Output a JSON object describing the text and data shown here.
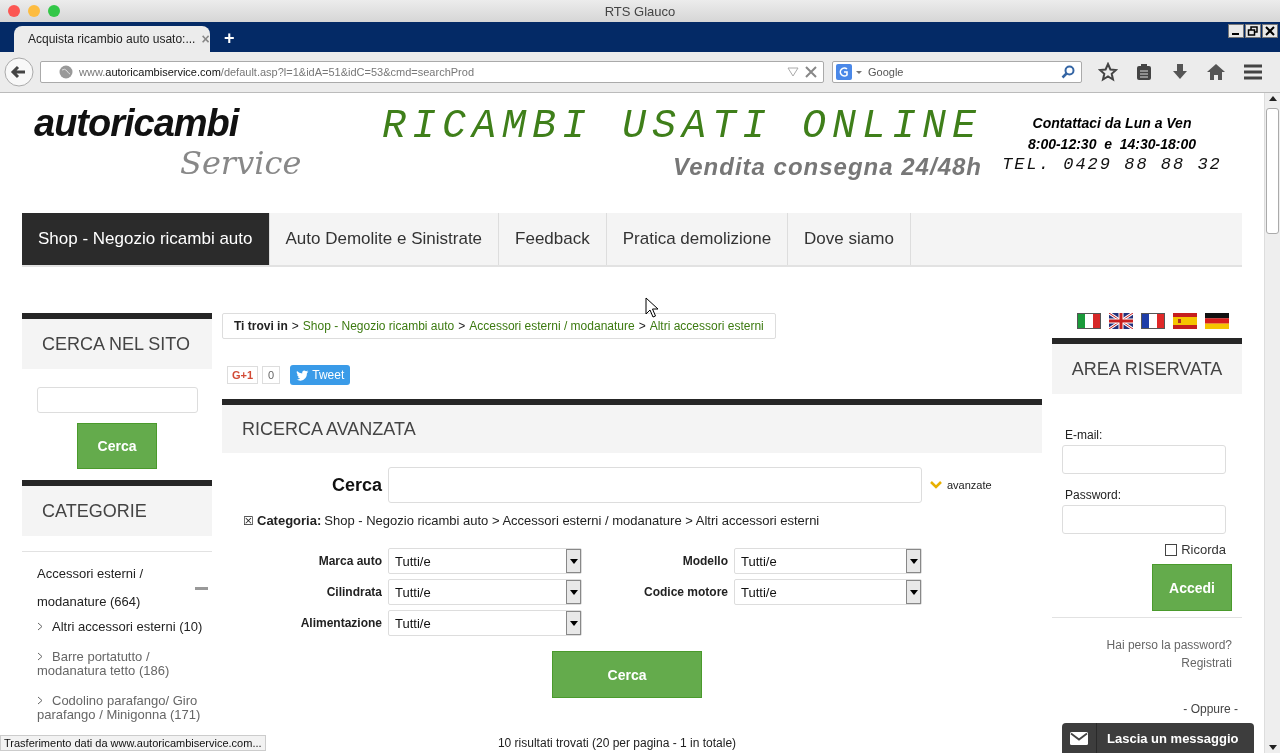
{
  "window": {
    "title": "RTS Glauco"
  },
  "browser": {
    "tab": {
      "title": "Acquista ricambio auto usato:...",
      "close": "×",
      "selected": true
    },
    "new_tab": "+",
    "url": {
      "prefix": "www.",
      "domain": "autoricambiservice.com",
      "path": "/default.asp?l=1&idA=51&idC=53&cmd=searchProd"
    },
    "search": {
      "placeholder": "Google"
    }
  },
  "header": {
    "logo_top": "autoricambi",
    "logo_bottom": "Service",
    "slogan": "RICAMBI USATI ONLINE",
    "subslogan": "Vendita consegna 24/48h",
    "contact": [
      "Contattaci da Lun a Ven",
      "8:00-12:30  e  14:30-18:00",
      "TEL. 0429 88 88 32"
    ]
  },
  "menu": [
    {
      "label": "Shop - Negozio ricambi auto",
      "selected": true
    },
    {
      "label": "Auto Demolite e Sinistrate",
      "selected": false
    },
    {
      "label": "Feedback",
      "selected": false
    },
    {
      "label": "Pratica demolizione",
      "selected": false
    },
    {
      "label": "Dove siamo",
      "selected": false
    }
  ],
  "sidebar_search": {
    "title": "CERCA NEL SITO",
    "button": "Cerca"
  },
  "categories": {
    "title": "CATEGORIE",
    "items": [
      {
        "label": "Accessori esterni / modanature (664)",
        "expanded": true,
        "children": [
          {
            "label": "Altri accessori esterni (10)",
            "selected": true
          },
          {
            "label": "Barre portatutto / modanatura tetto (186)",
            "selected": false
          },
          {
            "label": "Codolino parafango/ Giro parafango / Minigonna (171)",
            "selected": false
          }
        ]
      }
    ]
  },
  "breadcrumb": {
    "prefix": "Ti trovi in",
    "separator": ">",
    "items": [
      "Shop - Negozio ricambi auto",
      "Accessori esterni / modanature",
      "Altri accessori esterni"
    ]
  },
  "social": {
    "gplus": "G+1",
    "gplus_count": "0",
    "tweet": "Tweet"
  },
  "advanced_search": {
    "title": "RICERCA AVANZATA",
    "search_label": "Cerca",
    "toggle": "avanzate",
    "category_remove": "☒",
    "category_label": "Categoria:",
    "category_value": "Shop - Negozio ricambi auto > Accessori esterni / modanature > Altri accessori esterni",
    "filters": [
      {
        "label": "Marca auto",
        "value": "Tutti/e"
      },
      {
        "label": "Modello",
        "value": "Tutti/e"
      },
      {
        "label": "Cilindrata",
        "value": "Tutti/e"
      },
      {
        "label": "Codice motore",
        "value": "Tutti/e"
      },
      {
        "label": "Alimentazione",
        "value": "Tutti/e"
      }
    ],
    "button": "Cerca",
    "results": "10 risultati trovati (20 per pagina - 1 in totale)"
  },
  "login": {
    "title": "AREA RISERVATA",
    "email_label": "E-mail:",
    "password_label": "Password:",
    "remember": {
      "label": "Ricorda",
      "checked": false
    },
    "button": "Accedi",
    "links": [
      "Hai perso la password?",
      "Registrati"
    ],
    "or": "- Oppure -"
  },
  "chat": {
    "label": "Lascia un messaggio"
  },
  "status_bar": "Trasferimento dati da www.autoricambiservice.com..."
}
